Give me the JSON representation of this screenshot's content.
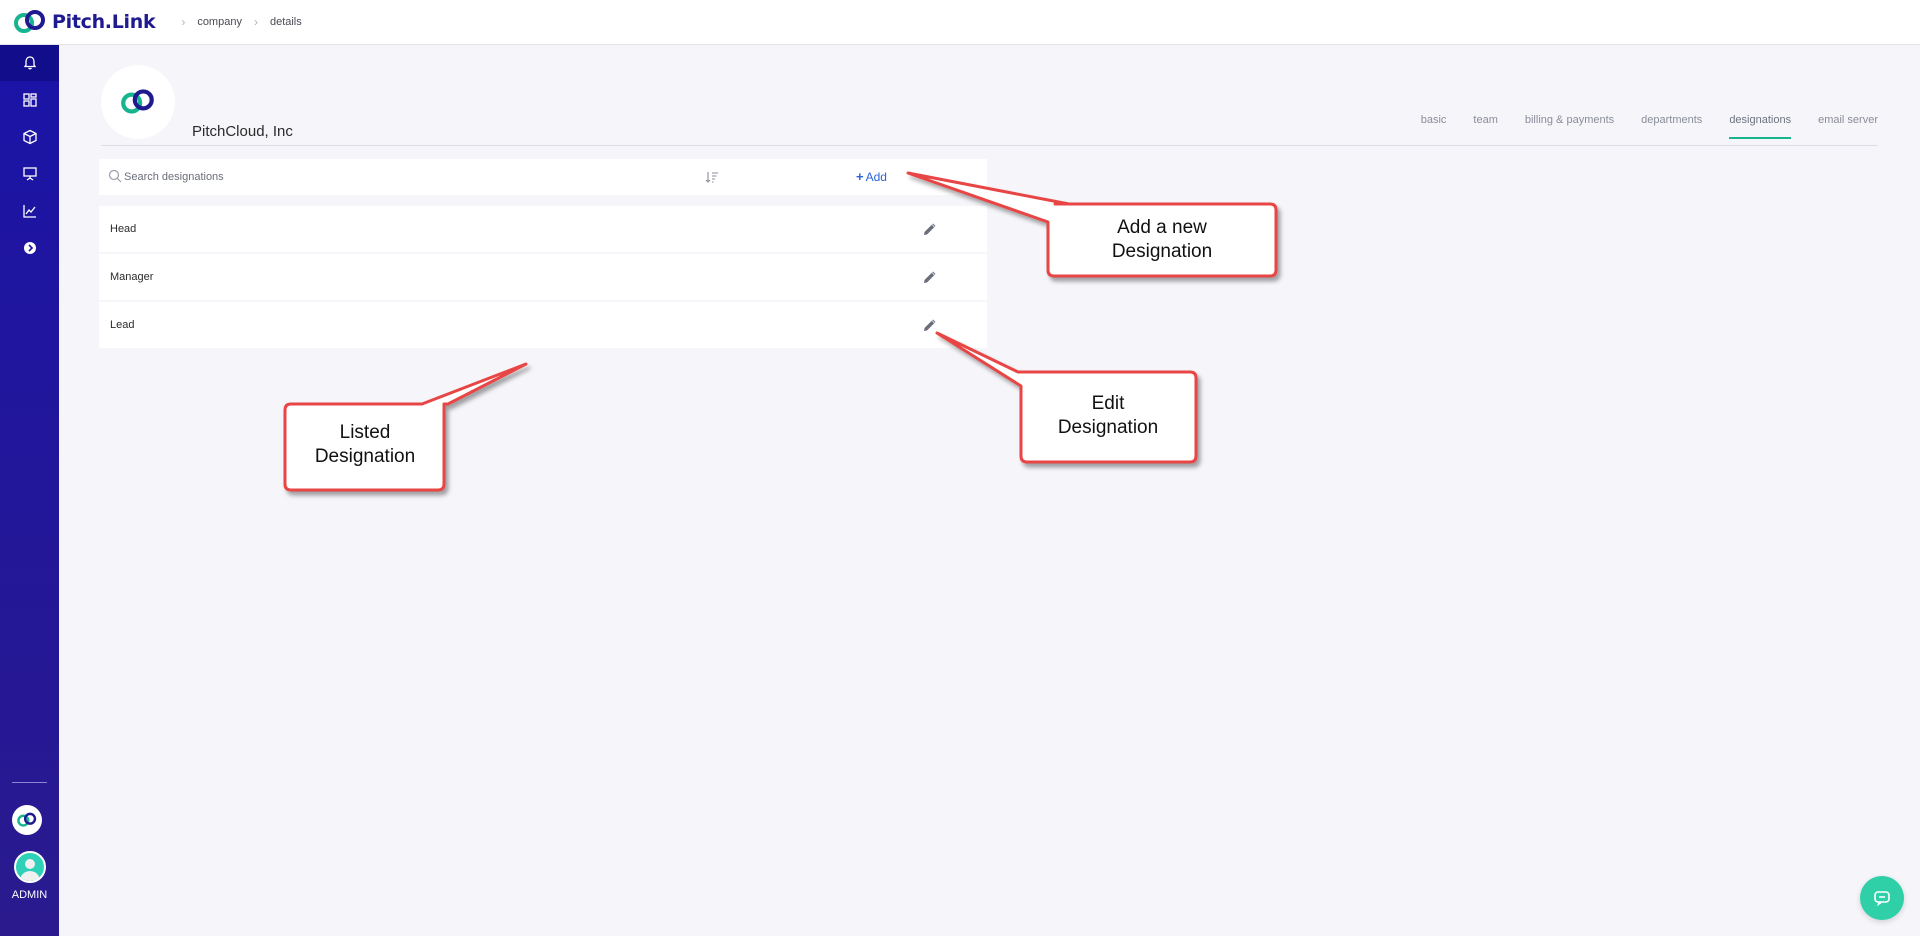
{
  "app": {
    "name": "Pitch.Link"
  },
  "breadcrumb": [
    "company",
    "details"
  ],
  "sidebar": {
    "items": [
      {
        "icon": "bell-icon"
      },
      {
        "icon": "dashboard-icon"
      },
      {
        "icon": "cube-icon"
      },
      {
        "icon": "presentation-icon"
      },
      {
        "icon": "analytics-icon"
      },
      {
        "icon": "arrow-circle-icon"
      }
    ],
    "admin_label": "ADMIN"
  },
  "company": {
    "name": "PitchCloud, Inc"
  },
  "tabs": [
    {
      "label": "basic"
    },
    {
      "label": "team"
    },
    {
      "label": "billing & payments"
    },
    {
      "label": "departments"
    },
    {
      "label": "designations",
      "active": true
    },
    {
      "label": "email server"
    }
  ],
  "toolbar": {
    "search_placeholder": "Search designations",
    "add_label": "Add"
  },
  "designations": [
    {
      "name": "Head"
    },
    {
      "name": "Manager"
    },
    {
      "name": "Lead"
    }
  ],
  "callouts": {
    "add": [
      "Add a new",
      "Designation"
    ],
    "edit": [
      "Edit",
      "Designation"
    ],
    "listed": [
      "Listed",
      "Designation"
    ]
  },
  "colors": {
    "sidebar": "#1a13a6",
    "brand": "#1f1a8f",
    "accent": "#17b58f",
    "link": "#2a64d8",
    "callout_stroke": "#e84545"
  }
}
